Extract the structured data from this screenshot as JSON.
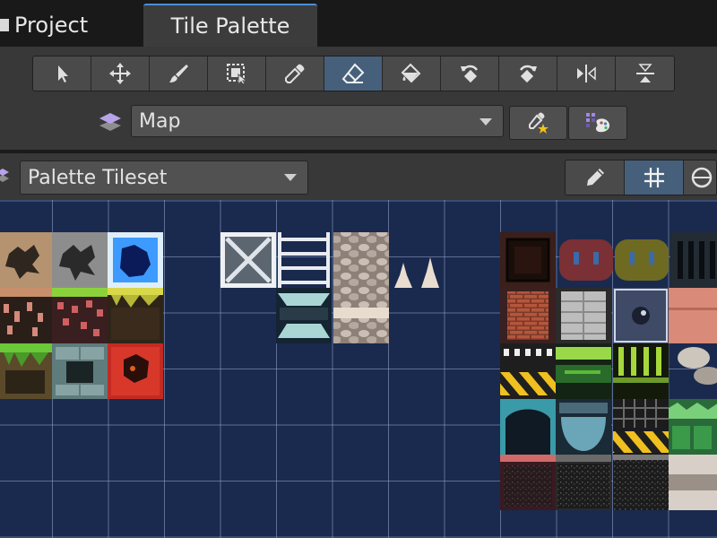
{
  "tabs": {
    "project": "Project",
    "tile_palette": "Tile Palette",
    "active": "Tile Palette"
  },
  "toolbar": {
    "tools": [
      {
        "icon": "select-arrow-icon"
      },
      {
        "icon": "move-icon"
      },
      {
        "icon": "paintbrush-icon"
      },
      {
        "icon": "box-fill-icon"
      },
      {
        "icon": "picker-icon"
      },
      {
        "icon": "eraser-icon",
        "active": true
      },
      {
        "icon": "fill-bucket-icon"
      },
      {
        "icon": "rotate-ccw-icon"
      },
      {
        "icon": "rotate-cw-icon"
      },
      {
        "icon": "flip-x-icon"
      },
      {
        "icon": "flip-y-icon"
      }
    ],
    "accent": "#46607c"
  },
  "target": {
    "selected": "Map",
    "icon": "layers-icon"
  },
  "palette": {
    "selected": "Palette Tileset",
    "edit_icon": "pencil-icon",
    "grid_icon": "grid-icon",
    "gizmo_icon": "gizmo-icon"
  },
  "grid": {
    "background": "#1a2a4e",
    "line": "#96a5cd"
  }
}
